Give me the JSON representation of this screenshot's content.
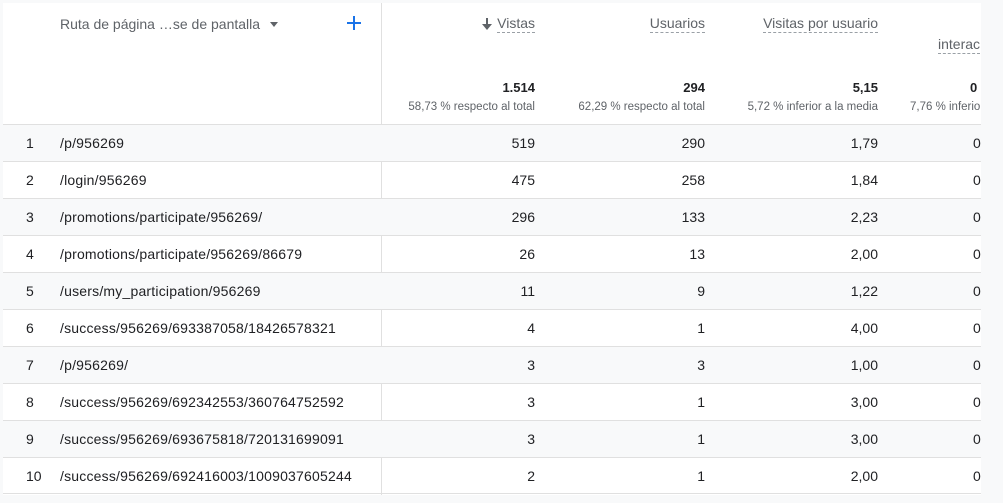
{
  "dimension": {
    "label": "Ruta de página …se de pantalla"
  },
  "columns": [
    {
      "label": "Vistas",
      "total": "1.514",
      "total_note": "58,73 % respecto al total",
      "sorted": true
    },
    {
      "label": "Usuarios",
      "total": "294",
      "total_note": "62,29 % respecto al total"
    },
    {
      "label": "Visitas por usuario",
      "total": "5,15",
      "total_note": "5,72 % inferior a la media"
    },
    {
      "label": "interac",
      "total": "0",
      "total_note": "7,76 % inferio"
    }
  ],
  "rows": [
    {
      "idx": "1",
      "path": "/p/956269",
      "views": "519",
      "users": "290",
      "vpu": "1,79",
      "cut": "0"
    },
    {
      "idx": "2",
      "path": "/login/956269",
      "views": "475",
      "users": "258",
      "vpu": "1,84",
      "cut": "0"
    },
    {
      "idx": "3",
      "path": "/promotions/participate/956269/",
      "views": "296",
      "users": "133",
      "vpu": "2,23",
      "cut": "0"
    },
    {
      "idx": "4",
      "path": "/promotions/participate/956269/86679",
      "views": "26",
      "users": "13",
      "vpu": "2,00",
      "cut": "0"
    },
    {
      "idx": "5",
      "path": "/users/my_participation/956269",
      "views": "11",
      "users": "9",
      "vpu": "1,22",
      "cut": "0"
    },
    {
      "idx": "6",
      "path": "/success/956269/693387058/18426578321",
      "views": "4",
      "users": "1",
      "vpu": "4,00",
      "cut": "0"
    },
    {
      "idx": "7",
      "path": "/p/956269/",
      "views": "3",
      "users": "3",
      "vpu": "1,00",
      "cut": "0"
    },
    {
      "idx": "8",
      "path": "/success/956269/692342553/360764752592",
      "views": "3",
      "users": "1",
      "vpu": "3,00",
      "cut": "0"
    },
    {
      "idx": "9",
      "path": "/success/956269/693675818/720131699091",
      "views": "3",
      "users": "1",
      "vpu": "3,00",
      "cut": "0"
    },
    {
      "idx": "10",
      "path": "/success/956269/692416003/1009037605244",
      "views": "2",
      "users": "1",
      "vpu": "2,00",
      "cut": "0"
    }
  ],
  "colors": {
    "accent": "#1a73e8",
    "border": "#e0e0e0",
    "alt_row": "#f8f9fa",
    "muted": "#5f6368"
  },
  "icons": {
    "add": "plus-icon",
    "sort": "arrow-down-icon",
    "dropdown": "caret-down-icon"
  }
}
